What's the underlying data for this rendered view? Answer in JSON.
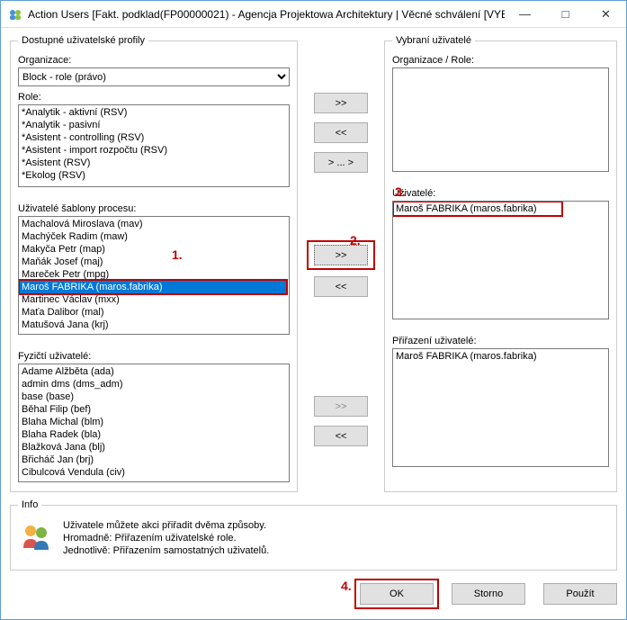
{
  "window": {
    "title": "Action Users [Fakt. podklad(FP00000021) - Agencja Projektowa Architektury | Věcné schválení [VYB..."
  },
  "groups": {
    "available": "Dostupné uživatelské profily",
    "selected": "Vybraní uživatelé",
    "info": "Info"
  },
  "labels": {
    "org": "Organizace:",
    "role": "Role:",
    "templateUsers": "Uživatelé šablony procesu:",
    "physicalUsers": "Fyzičtí uživatelé:",
    "orgRole": "Organizace / Role:",
    "users": "Uživatelé:",
    "assignment": "Přiřazení uživatelé:"
  },
  "org": {
    "selected": "Block - role (právo)"
  },
  "roles": [
    "*Analytik - aktivní (RSV)",
    "*Analytik - pasivní",
    "*Asistent - controlling (RSV)",
    "*Asistent - import rozpočtu (RSV)",
    "*Asistent (RSV)",
    "*Ekolog (RSV)"
  ],
  "templateUsers": [
    "Machalová Miroslava (mav)",
    "Machýček Radim (maw)",
    "Makyča Petr (map)",
    "Maňák Josef (maj)",
    "Mareček Petr (mpg)",
    "Maroš FABRIKA (maros.fabrika)",
    "Martinec Václav (mxx)",
    "Maťa Dalibor (mal)",
    "Matušová Jana (krj)"
  ],
  "templateSelectedIndex": 5,
  "physicalUsers": [
    "Adame Alžběta (ada)",
    "admin dms (dms_adm)",
    "base (base)",
    "Běhal Filip (bef)",
    "Blaha Michal (blm)",
    "Blaha Radek (bla)",
    "Blažková Jana (blj)",
    "Břicháč Jan (brj)",
    "Cibulcová Vendula (civ)"
  ],
  "rightUsers": [
    "Maroš FABRIKA (maros.fabrika)"
  ],
  "rightAssignments": [
    "Maroš FABRIKA (maros.fabrika)"
  ],
  "moveBtns": {
    "r1": ">>",
    "l1": "<<",
    "ellipsis": "> ... >",
    "r2": ">>",
    "l2": "<<",
    "r3": ">>",
    "l3": "<<"
  },
  "info": {
    "line1": "Uživatele můžete akci přiřadit dvěma způsoby.",
    "line2": "Hromadně: Přiřazením uživatelské role.",
    "line3": "Jednotlivě: Přiřazením samostatných uživatelů."
  },
  "buttons": {
    "ok": "OK",
    "cancel": "Storno",
    "apply": "Použít"
  },
  "annotations": {
    "n1": "1.",
    "n2": "2.",
    "n3": "3.",
    "n4": "4."
  }
}
